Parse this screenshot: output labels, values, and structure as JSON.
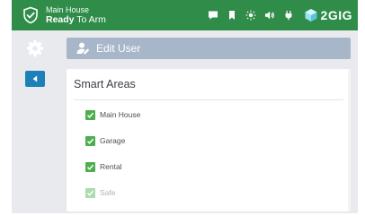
{
  "status": {
    "area_name": "Main House",
    "state_prefix": "Ready",
    "state_suffix": " To Arm",
    "brand": "2GIG",
    "icons": [
      "shield-check-icon",
      "message-icon",
      "bookmark-icon",
      "brightness-icon",
      "volume-icon",
      "power-plug-icon",
      "2gig-logo-icon"
    ]
  },
  "nav": {
    "settings_icon": "gear-icon",
    "back_icon": "back-arrow-icon"
  },
  "header": {
    "title": "Edit User",
    "icon": "user-edit-icon"
  },
  "panel": {
    "title": "Smart Areas",
    "areas": [
      {
        "label": "Main House",
        "checked": true
      },
      {
        "label": "Garage",
        "checked": true
      },
      {
        "label": "Rental",
        "checked": true
      },
      {
        "label": "Safe",
        "checked": true
      }
    ]
  },
  "colors": {
    "status_bar": "#2f8d49",
    "header_bar": "#a8b6c9",
    "back_button": "#1f7fb8",
    "check": "#4cae4f",
    "background": "#e8eaee"
  }
}
